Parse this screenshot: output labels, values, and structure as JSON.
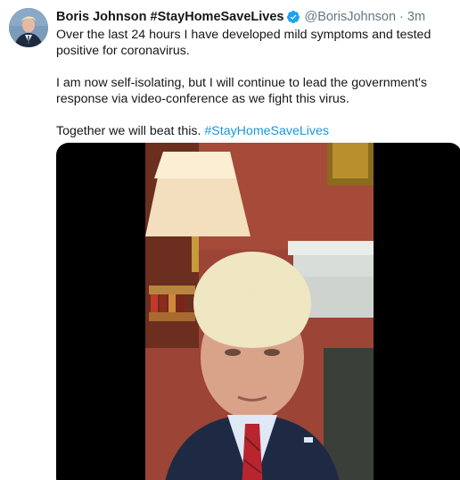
{
  "tweet": {
    "display_name": "Boris Johnson #StayHomeSaveLives",
    "handle": "@BorisJohnson",
    "separator": "·",
    "time": "3m",
    "paragraph_1": "Over the last 24 hours I have developed mild symptoms and tested positive for coronavirus.",
    "paragraph_2": "I am now self-isolating, but I will continue to lead the government's response via video-conference as we fight this virus.",
    "paragraph_3_text": "Together we will beat this.",
    "paragraph_3_hashtag": "#StayHomeSaveLives"
  },
  "icons": {
    "verified": "verified-badge-icon"
  },
  "colors": {
    "link": "#1b95e0",
    "secondary_text": "#657786",
    "verified": "#1da1f2",
    "video_background": "#000000"
  }
}
